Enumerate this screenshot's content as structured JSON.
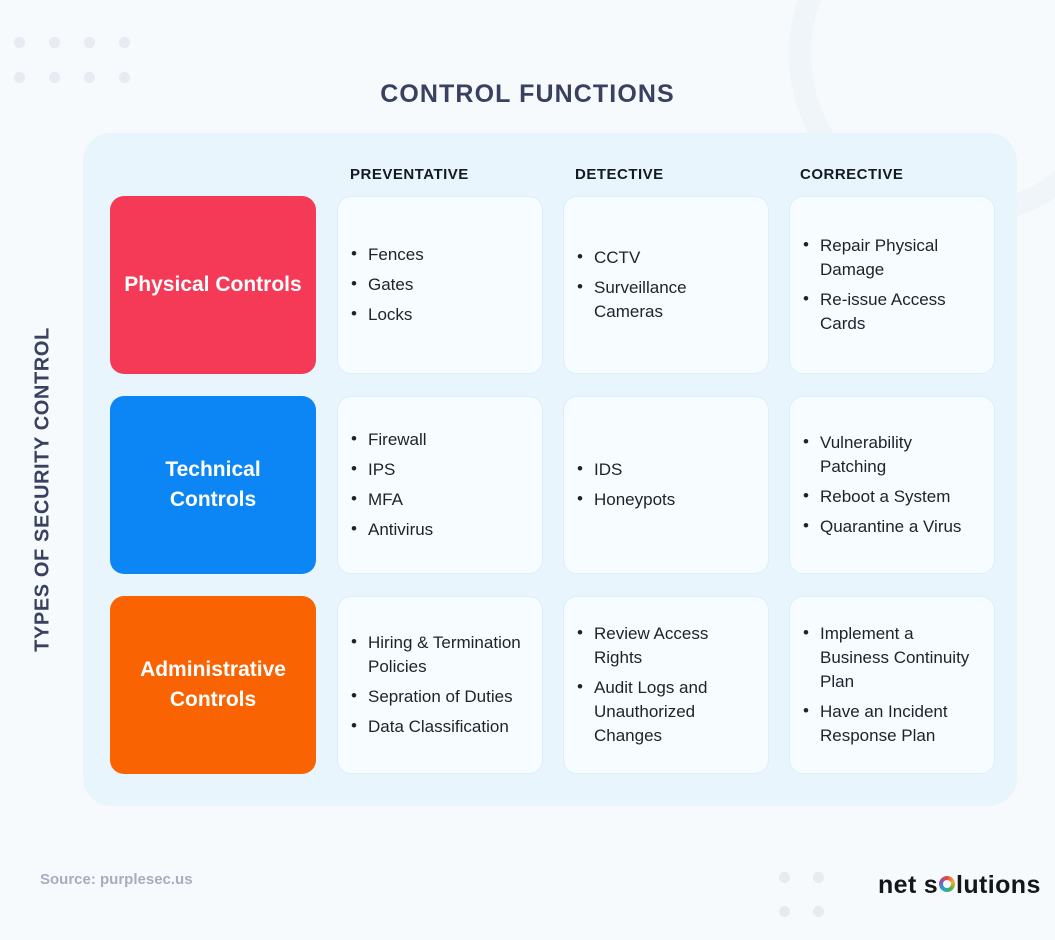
{
  "title": "CONTROL FUNCTIONS",
  "axis_label": "TYPES OF SECURITY CONTROL",
  "columns": [
    {
      "label": "PREVENTATIVE"
    },
    {
      "label": "DETECTIVE"
    },
    {
      "label": "CORRECTIVE"
    }
  ],
  "rows": [
    {
      "category": "Physical Controls",
      "color": "#f43a56",
      "cells": [
        {
          "items": [
            "Fences",
            "Gates",
            "Locks"
          ]
        },
        {
          "items": [
            "CCTV",
            "Surveillance Cameras"
          ]
        },
        {
          "items": [
            "Repair Physical Damage",
            "Re-issue Access Cards"
          ]
        }
      ]
    },
    {
      "category": "Technical Controls",
      "color": "#0d86f5",
      "cells": [
        {
          "items": [
            "Firewall",
            "IPS",
            "MFA",
            "Antivirus"
          ]
        },
        {
          "items": [
            "IDS",
            "Honeypots"
          ]
        },
        {
          "items": [
            "Vulnerability Patching",
            "Reboot a System",
            "Quarantine a Virus"
          ]
        }
      ]
    },
    {
      "category": "Administrative Controls",
      "color": "#f96302",
      "cells": [
        {
          "items": [
            "Hiring & Termination Policies",
            "Sepration of Duties",
            "Data Classification"
          ]
        },
        {
          "items": [
            "Review Access Rights",
            "Audit Logs and Unauthorized Changes"
          ]
        },
        {
          "items": [
            "Implement a Business Continuity Plan",
            "Have an Incident Response Plan"
          ]
        }
      ]
    }
  ],
  "footer": {
    "source": "Source: purplesec.us",
    "logo_part1": "net",
    "logo_part2": "s",
    "logo_part3": "lutions"
  },
  "colors": {
    "page_background": "#f7fafd",
    "panel_background": "#e9f5fd",
    "card_background": "#f6fcff",
    "card_border": "#dbeefb",
    "title_text": "#3a4160",
    "header_text": "#141a24",
    "body_text": "#1d222b",
    "source_text": "#a7adba",
    "dot": "#e6eaf1"
  },
  "decorations": {
    "top_left_dots": "dot-grid-4x2",
    "bottom_right_dots": "dot-grid-2x2",
    "top_right_arc": "circle-outline-arc"
  }
}
